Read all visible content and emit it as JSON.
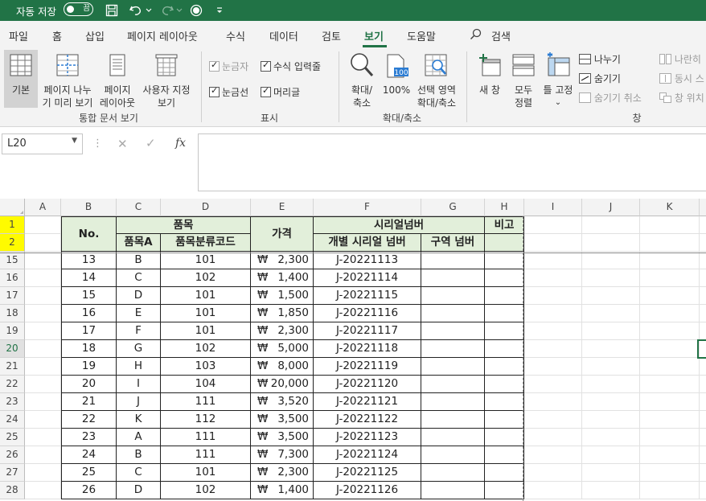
{
  "titlebar": {
    "autosave_label": "자동 저장",
    "autosave_state": "끔",
    "bg_color": "#217346"
  },
  "menu": {
    "tabs": [
      "파일",
      "홈",
      "삽입",
      "페이지 레이아웃",
      "수식",
      "데이터",
      "검토",
      "보기",
      "도움말"
    ],
    "active_tab": "보기",
    "search_label": "검색"
  },
  "ribbon": {
    "workbook_views": {
      "normal": "기본",
      "page_break_line1": "페이지 나누",
      "page_break_line2": "기 미리 보기",
      "page_layout_line1": "페이지",
      "page_layout_line2": "레이아웃",
      "custom_line1": "사용자 지정",
      "custom_line2": "보기",
      "group_label": "통합 문서 보기"
    },
    "show": {
      "ruler": "눈금자",
      "formula_bar": "수식 입력줄",
      "gridlines": "눈금선",
      "headings": "머리글",
      "group_label": "표시"
    },
    "zoom": {
      "zoom_line1": "확대/",
      "zoom_line2": "축소",
      "hundred": "100%",
      "zoom_sel_line1": "선택 영역",
      "zoom_sel_line2": "확대/축소",
      "group_label": "확대/축소"
    },
    "window": {
      "new_window": "새 창",
      "arrange_line1": "모두",
      "arrange_line2": "정렬",
      "freeze_panes": "틀 고정",
      "split": "나누기",
      "hide": "숨기기",
      "unhide": "숨기기 취소",
      "side_by_side": "나란히",
      "sync_scroll": "동시 스",
      "reset_pos": "창 위치",
      "group_label": "창"
    }
  },
  "formula_bar": {
    "name_box": "L20",
    "fx_label": "fx",
    "content": ""
  },
  "grid": {
    "columns": [
      "A",
      "B",
      "C",
      "D",
      "E",
      "F",
      "G",
      "H",
      "I",
      "J",
      "K"
    ],
    "header_row1": {
      "no": "No.",
      "item": "품목",
      "price": "가격",
      "serial": "시리얼넘버",
      "note": "비고"
    },
    "header_row2": {
      "item_a": "품목A",
      "item_code": "품목분류코드",
      "serial_each": "개별 시리얼 넘버",
      "serial_zone": "구역 넘버"
    },
    "frozen_rows": [
      "1",
      "2"
    ],
    "currency_symbol": "₩",
    "rows": [
      {
        "row": "15",
        "no": "13",
        "item": "B",
        "code": "101",
        "price": "2,300",
        "serial": "J-20221113"
      },
      {
        "row": "16",
        "no": "14",
        "item": "C",
        "code": "102",
        "price": "1,400",
        "serial": "J-20221114"
      },
      {
        "row": "17",
        "no": "15",
        "item": "D",
        "code": "101",
        "price": "1,500",
        "serial": "J-20221115"
      },
      {
        "row": "18",
        "no": "16",
        "item": "E",
        "code": "101",
        "price": "1,850",
        "serial": "J-20221116"
      },
      {
        "row": "19",
        "no": "17",
        "item": "F",
        "code": "101",
        "price": "2,300",
        "serial": "J-20221117"
      },
      {
        "row": "20",
        "no": "18",
        "item": "G",
        "code": "102",
        "price": "5,000",
        "serial": "J-20221118"
      },
      {
        "row": "21",
        "no": "19",
        "item": "H",
        "code": "103",
        "price": "8,000",
        "serial": "J-20221119"
      },
      {
        "row": "22",
        "no": "20",
        "item": "I",
        "code": "104",
        "price": "20,000",
        "serial": "J-20221120"
      },
      {
        "row": "23",
        "no": "21",
        "item": "J",
        "code": "111",
        "price": "3,520",
        "serial": "J-20221121"
      },
      {
        "row": "24",
        "no": "22",
        "item": "K",
        "code": "112",
        "price": "3,500",
        "serial": "J-20221122"
      },
      {
        "row": "25",
        "no": "23",
        "item": "A",
        "code": "111",
        "price": "3,500",
        "serial": "J-20221123"
      },
      {
        "row": "26",
        "no": "24",
        "item": "B",
        "code": "111",
        "price": "7,300",
        "serial": "J-20221124"
      },
      {
        "row": "27",
        "no": "25",
        "item": "C",
        "code": "101",
        "price": "2,300",
        "serial": "J-20221125"
      },
      {
        "row": "28",
        "no": "26",
        "item": "D",
        "code": "102",
        "price": "1,400",
        "serial": "J-20221126"
      }
    ],
    "selected_row": "20",
    "header_fill_color": "#e2efda",
    "highlight_color": "#fffb00"
  }
}
